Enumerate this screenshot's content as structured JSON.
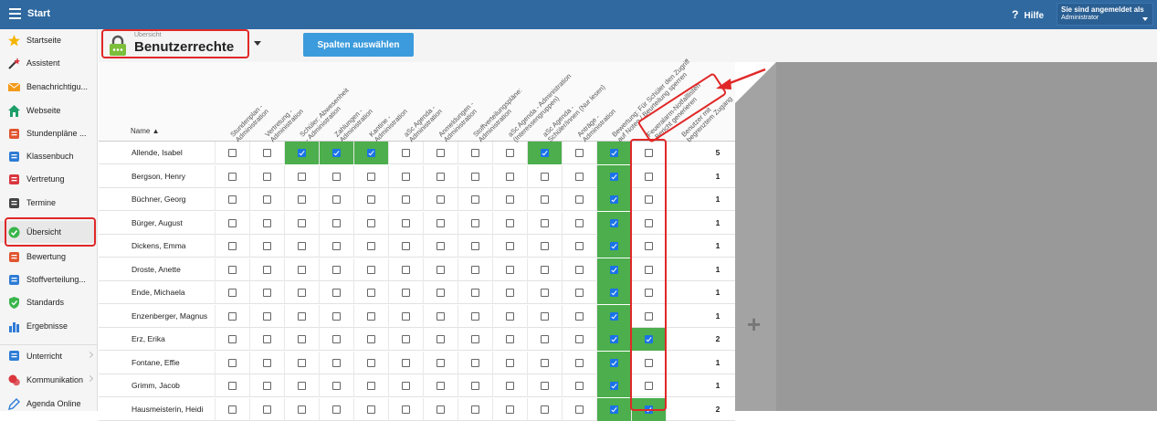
{
  "topbar": {
    "title": "Start",
    "help_label": "Hilfe",
    "help_icon": "?",
    "user_label": "Sie sind angemeldet als",
    "user_role": "Administrator"
  },
  "sidebar": {
    "items": [
      {
        "label": "Startseite",
        "icon": "star-icon",
        "color": "#f5b400"
      },
      {
        "label": "Assistent",
        "icon": "wand-icon",
        "color": "#d9363e"
      },
      {
        "label": "Benachrichtigu...",
        "icon": "envelope-icon",
        "color": "#f29a1a"
      },
      {
        "label": "Webseite",
        "icon": "home-icon",
        "color": "#1e9e68"
      },
      {
        "label": "Stundenpläne ...",
        "icon": "calendar-grid-icon",
        "color": "#e0552f"
      },
      {
        "label": "Klassenbuch",
        "icon": "book-icon",
        "color": "#2e7cd6"
      },
      {
        "label": "Vertretung",
        "icon": "swap-icon",
        "color": "#d9363e"
      },
      {
        "label": "Termine",
        "icon": "calendar-icon",
        "color": "#444444"
      },
      {
        "label": "Übersicht",
        "icon": "check-circle-icon",
        "color": "#3ab54a"
      },
      {
        "label": "Bewertung",
        "icon": "grade-icon",
        "color": "#e0552f"
      },
      {
        "label": "Stoffverteilung...",
        "icon": "briefcase-icon",
        "color": "#2e7cd6"
      },
      {
        "label": "Standards",
        "icon": "shield-icon",
        "color": "#3ab54a"
      },
      {
        "label": "Ergebnisse",
        "icon": "bar-chart-icon",
        "color": "#2e7cd6"
      },
      {
        "label": "Unterricht",
        "icon": "school-icon",
        "color": "#2e7cd6"
      },
      {
        "label": "Kommunikation",
        "icon": "chat-icon",
        "color": "#d9363e"
      },
      {
        "label": "Agenda Online",
        "icon": "pencil-icon",
        "color": "#2e7cd6"
      }
    ]
  },
  "header": {
    "subtitle": "Übersicht",
    "title": "Benutzerrechte",
    "columns_button": "Spalten auswählen"
  },
  "table": {
    "name_header": "Name ▲",
    "columns": [
      "Stundenplan -\nAdministration",
      "Vertretung -\nAdministration",
      "Schüler: Abwesenheit\n- Administration",
      "Zahlungen -\nAdministration",
      "Kantine -\nAdministration",
      "aSc Agenda -\nAdministration",
      "Anmeldungen -\nAdministration",
      "Stoffverteilungspläne:\nAdministration",
      "aSc Agenda - Administration\n(Interessengruppen)",
      "aSc Agenda -\nSchüler/innen (Nur lesen)",
      "Anträge -\nAdministration",
      "Bewertung: Für Schüler den Zugriff\nauf Noten / Beurteilung sperren",
      "Feueralarm-Notfalllisten\n- Bericht generieren",
      "Benutzer mit\nbegrenztem Zugang"
    ],
    "rows": [
      {
        "name": "Allende, Isabel",
        "checks": [
          0,
          0,
          1,
          1,
          1,
          0,
          0,
          0,
          0,
          1,
          0,
          1,
          0
        ],
        "count": "5"
      },
      {
        "name": "Bergson, Henry",
        "checks": [
          0,
          0,
          0,
          0,
          0,
          0,
          0,
          0,
          0,
          0,
          0,
          1,
          0
        ],
        "count": "1"
      },
      {
        "name": "Büchner, Georg",
        "checks": [
          0,
          0,
          0,
          0,
          0,
          0,
          0,
          0,
          0,
          0,
          0,
          1,
          0
        ],
        "count": "1"
      },
      {
        "name": "Bürger, August",
        "checks": [
          0,
          0,
          0,
          0,
          0,
          0,
          0,
          0,
          0,
          0,
          0,
          1,
          0
        ],
        "count": "1"
      },
      {
        "name": "Dickens, Emma",
        "checks": [
          0,
          0,
          0,
          0,
          0,
          0,
          0,
          0,
          0,
          0,
          0,
          1,
          0
        ],
        "count": "1"
      },
      {
        "name": "Droste, Anette",
        "checks": [
          0,
          0,
          0,
          0,
          0,
          0,
          0,
          0,
          0,
          0,
          0,
          1,
          0
        ],
        "count": "1"
      },
      {
        "name": "Ende, Michaela",
        "checks": [
          0,
          0,
          0,
          0,
          0,
          0,
          0,
          0,
          0,
          0,
          0,
          1,
          0
        ],
        "count": "1"
      },
      {
        "name": "Enzenberger, Magnus",
        "checks": [
          0,
          0,
          0,
          0,
          0,
          0,
          0,
          0,
          0,
          0,
          0,
          1,
          0
        ],
        "count": "1"
      },
      {
        "name": "Erz, Erika",
        "checks": [
          0,
          0,
          0,
          0,
          0,
          0,
          0,
          0,
          0,
          0,
          0,
          1,
          1
        ],
        "count": "2"
      },
      {
        "name": "Fontane, Effie",
        "checks": [
          0,
          0,
          0,
          0,
          0,
          0,
          0,
          0,
          0,
          0,
          0,
          1,
          0
        ],
        "count": "1"
      },
      {
        "name": "Grimm, Jacob",
        "checks": [
          0,
          0,
          0,
          0,
          0,
          0,
          0,
          0,
          0,
          0,
          0,
          1,
          0
        ],
        "count": "1"
      },
      {
        "name": "Hausmeisterin, Heidi",
        "checks": [
          0,
          0,
          0,
          0,
          0,
          0,
          0,
          0,
          0,
          0,
          0,
          1,
          1
        ],
        "count": "2"
      }
    ]
  },
  "colors": {
    "topbar": "#2f69a0",
    "button": "#3b9bdc",
    "checked_cell": "#4cae4c",
    "highlight": "#e02828"
  }
}
